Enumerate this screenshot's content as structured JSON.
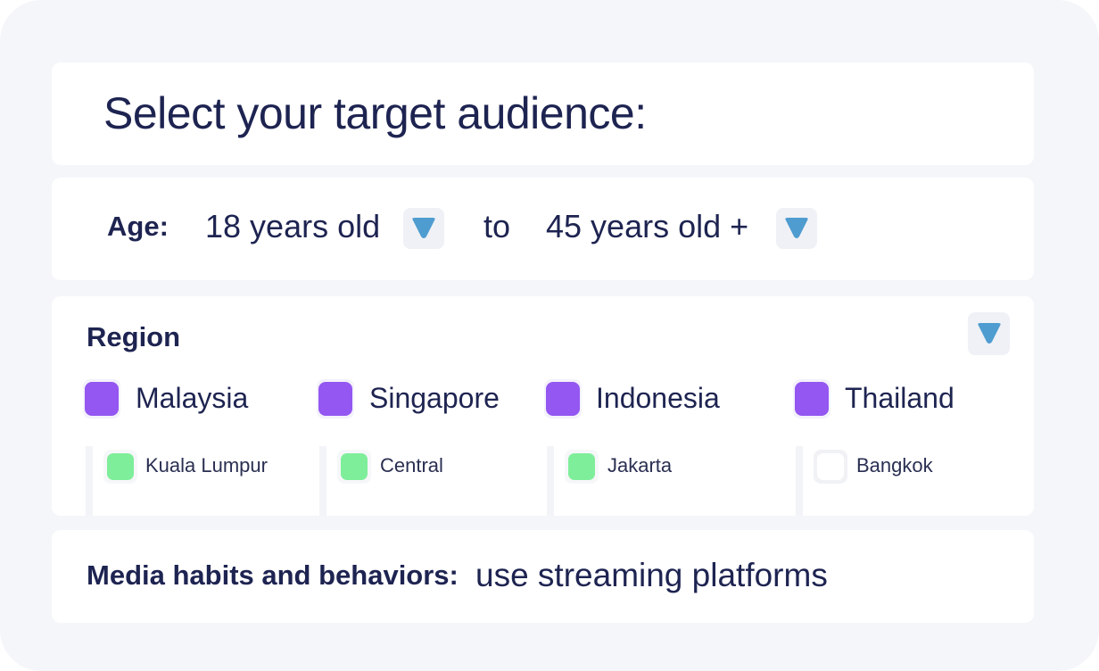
{
  "title": "Select your target audience:",
  "age": {
    "label": "Age:",
    "from_value": "18 years old",
    "to_word": "to",
    "to_value": "45 years old +"
  },
  "region": {
    "label": "Region",
    "countries": [
      {
        "name": "Malaysia",
        "checked": true,
        "city": {
          "name": "Kuala Lumpur",
          "checked": true
        }
      },
      {
        "name": "Singapore",
        "checked": true,
        "city": {
          "name": "Central",
          "checked": true
        }
      },
      {
        "name": "Indonesia",
        "checked": true,
        "city": {
          "name": "Jakarta",
          "checked": true
        }
      },
      {
        "name": "Thailand",
        "checked": true,
        "city": {
          "name": "Bangkok",
          "checked": false
        }
      }
    ]
  },
  "media": {
    "label": "Media habits and behaviors:",
    "value": "use streaming platforms"
  },
  "colors": {
    "text": "#1e2451",
    "country_check": "#9457f1",
    "city_check": "#7fee9a",
    "dropdown_icon": "#4f9cd0",
    "background": "#f5f6fa"
  },
  "icons": {
    "dropdown": "chevron-down-icon"
  }
}
